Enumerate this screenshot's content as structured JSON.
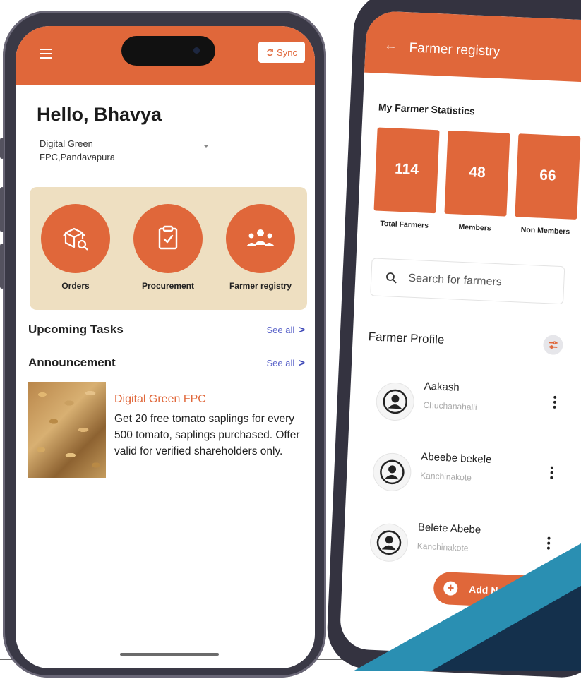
{
  "phone_home": {
    "header": {
      "sync_label": "Sync"
    },
    "greeting": "Hello, Bhavya",
    "organization": "Digital Green FPC,Pandavapura",
    "quick_actions": [
      {
        "label": "Orders",
        "icon": "box-search-icon"
      },
      {
        "label": "Procurement",
        "icon": "clipboard-check-icon"
      },
      {
        "label": "Farmer registry",
        "icon": "people-group-icon"
      }
    ],
    "upcoming_tasks": {
      "title": "Upcoming Tasks",
      "see_all": "See all"
    },
    "announcement": {
      "title": "Announcement",
      "see_all": "See all",
      "item_title": "Digital Green FPC",
      "item_body": "Get 20 free tomato saplings for every 500 tomato, saplings purchased. Offer valid for verified shareholders only."
    }
  },
  "phone_registry": {
    "header_title": "Farmer registry",
    "stats_title": "My Farmer Statistics",
    "stats": [
      {
        "value": "114",
        "label": "Total Farmers"
      },
      {
        "value": "48",
        "label": "Members"
      },
      {
        "value": "66",
        "label": "Non Members"
      }
    ],
    "search_placeholder": "Search for farmers",
    "profile_title": "Farmer Profile",
    "farmers": [
      {
        "name": "Aakash",
        "village": "Chuchanahalli"
      },
      {
        "name": "Abeebe bekele",
        "village": "Kanchinakote"
      },
      {
        "name": "Belete Abebe",
        "village": "Kanchinakote"
      }
    ],
    "fab_label": "Add New Fa"
  },
  "colors": {
    "accent": "#e0673a",
    "panel": "#eedfc1",
    "link": "#5a63c9",
    "teal": "#2a8fb2",
    "navy": "#14304c"
  }
}
